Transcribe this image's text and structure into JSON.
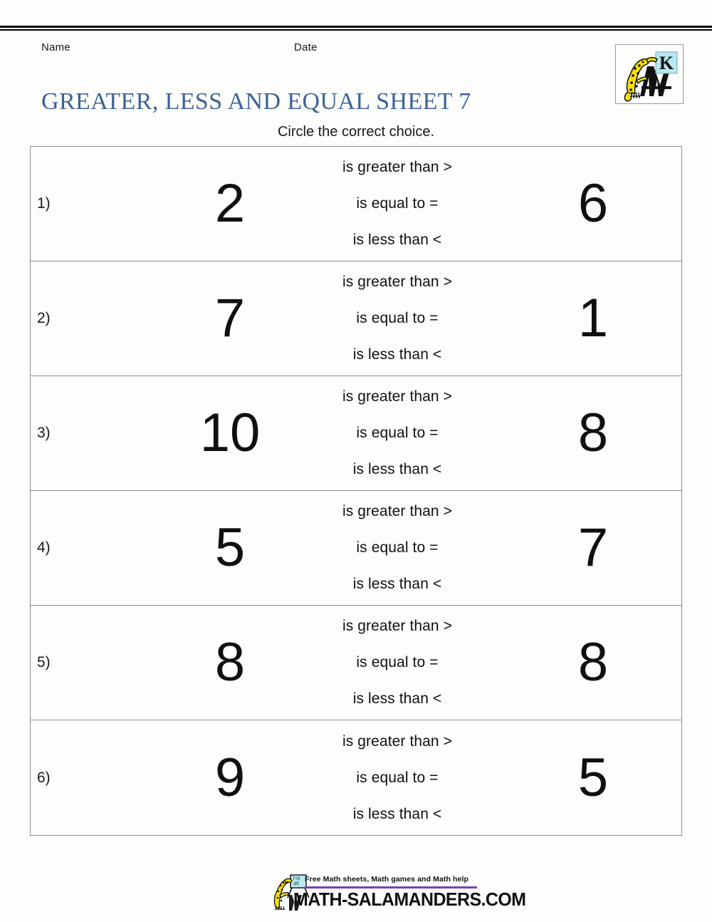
{
  "page": {
    "background_color": "#fdfdfb",
    "rule_color": "#000000"
  },
  "header": {
    "name_label": "Name",
    "date_label": "Date",
    "title": "GREATER, LESS AND EQUAL SHEET 7",
    "title_color": "#3c6398",
    "subtitle": "Circle the correct choice."
  },
  "logo": {
    "letter": "K",
    "letter_box_color": "#b9e7ef",
    "mascot_color": "#f5e000",
    "mark_color": "#111111",
    "border_color": "#9a9a9a"
  },
  "worksheet": {
    "choices": [
      "is greater than >",
      "is equal to =",
      "is less than <"
    ],
    "rows": [
      {
        "index": "1)",
        "left": "2",
        "right": "6"
      },
      {
        "index": "2)",
        "left": "7",
        "right": "1"
      },
      {
        "index": "3)",
        "left": "10",
        "right": "8"
      },
      {
        "index": "4)",
        "left": "5",
        "right": "7"
      },
      {
        "index": "5)",
        "left": "8",
        "right": "8"
      },
      {
        "index": "6)",
        "left": "9",
        "right": "5"
      }
    ]
  },
  "footer": {
    "tagline": "Free Math sheets, Math games and Math help",
    "domain": "MATH-SALAMANDERS.COM",
    "underline_color": "#7b3fb5",
    "mascot_color": "#f5e000",
    "board_color": "#b9e7ef"
  }
}
